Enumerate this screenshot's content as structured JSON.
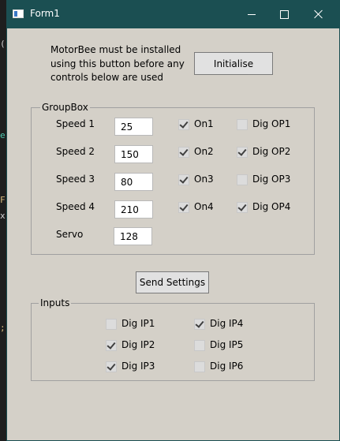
{
  "window": {
    "title": "Form1"
  },
  "info": {
    "text": "MotorBee must be installed using this button before any controls below are used"
  },
  "buttons": {
    "initialise": "Initialise",
    "send_settings": "Send Settings"
  },
  "groupbox": {
    "label": "GroupBox",
    "speeds": [
      {
        "label": "Speed 1",
        "value": "25",
        "on_label": "On1",
        "on_checked": true,
        "dig_label": "Dig OP1",
        "dig_checked": false
      },
      {
        "label": "Speed 2",
        "value": "150",
        "on_label": "On2",
        "on_checked": true,
        "dig_label": "Dig OP2",
        "dig_checked": true
      },
      {
        "label": "Speed 3",
        "value": "80",
        "on_label": "On3",
        "on_checked": true,
        "dig_label": "Dig OP3",
        "dig_checked": false
      },
      {
        "label": "Speed 4",
        "value": "210",
        "on_label": "On4",
        "on_checked": true,
        "dig_label": "Dig OP4",
        "dig_checked": true
      }
    ],
    "servo": {
      "label": "Servo",
      "value": "128"
    }
  },
  "inputs": {
    "label": "Inputs",
    "items": [
      {
        "label": "Dig IP1",
        "checked": false
      },
      {
        "label": "Dig IP2",
        "checked": true
      },
      {
        "label": "Dig IP3",
        "checked": true
      },
      {
        "label": "Dig IP4",
        "checked": true
      },
      {
        "label": "Dig IP5",
        "checked": false
      },
      {
        "label": "Dig IP6",
        "checked": false
      }
    ]
  },
  "colors": {
    "titlebar": "#1b4f52",
    "client": "#d4d0c8"
  }
}
